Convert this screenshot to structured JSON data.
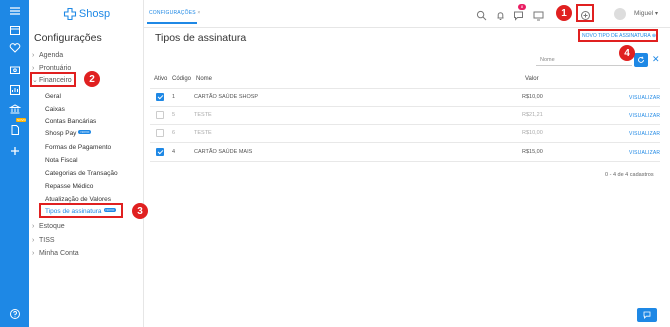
{
  "app": {
    "logo_text": "Shosp",
    "brand_color": "#1e88e5"
  },
  "topbar": {
    "tab_label": "CONFIGURAÇÕES",
    "tab_close": "×",
    "notification_count": "8",
    "user_name": "Miguel"
  },
  "rail": {
    "icons": [
      "menu-icon",
      "calendar-icon",
      "heart-icon",
      "wallet-icon",
      "chart-icon",
      "bank-icon",
      "document-icon",
      "plus-icon",
      "help-icon"
    ],
    "new_badge": "NOVO"
  },
  "sidebar": {
    "title": "Configurações",
    "items": [
      {
        "label": "Agenda"
      },
      {
        "label": "Prontuário"
      },
      {
        "label": "Financeiro"
      },
      {
        "label": "Estoque"
      },
      {
        "label": "TISS"
      },
      {
        "label": "Minha Conta"
      }
    ],
    "financeiro_sub": [
      {
        "label": "Geral"
      },
      {
        "label": "Caixas"
      },
      {
        "label": "Contas Bancárias"
      },
      {
        "label": "Shosp Pay",
        "badge": "NOVO"
      },
      {
        "label": "Formas de Pagamento"
      },
      {
        "label": "Nota Fiscal"
      },
      {
        "label": "Categorias de Transação"
      },
      {
        "label": "Repasse Médico"
      },
      {
        "label": "Atualização de Valores"
      },
      {
        "label": "Tipos de assinatura",
        "badge": "NOVO"
      }
    ]
  },
  "main": {
    "title": "Tipos de assinatura",
    "new_link": "NOVO TIPO DE ASSINATURA",
    "search_placeholder": "Nome",
    "columns": [
      "Ativo",
      "Código",
      "Nome",
      "Valor"
    ],
    "rows": [
      {
        "active": true,
        "code": "1",
        "name": "CARTÃO SAÚDE SHOSP",
        "value": "R$10,00",
        "action": "VISUALIZAR"
      },
      {
        "active": false,
        "code": "5",
        "name": "TESTE",
        "value": "R$21,21",
        "action": "VISUALIZAR"
      },
      {
        "active": false,
        "code": "6",
        "name": "TESTE",
        "value": "R$10,00",
        "action": "VISUALIZAR"
      },
      {
        "active": true,
        "code": "4",
        "name": "CARTÃO SAÚDE MAIS",
        "value": "R$15,00",
        "action": "VISUALIZAR"
      }
    ],
    "count_text": "0 - 4 de 4 cadastros"
  },
  "callouts": [
    "1",
    "2",
    "3",
    "4"
  ]
}
